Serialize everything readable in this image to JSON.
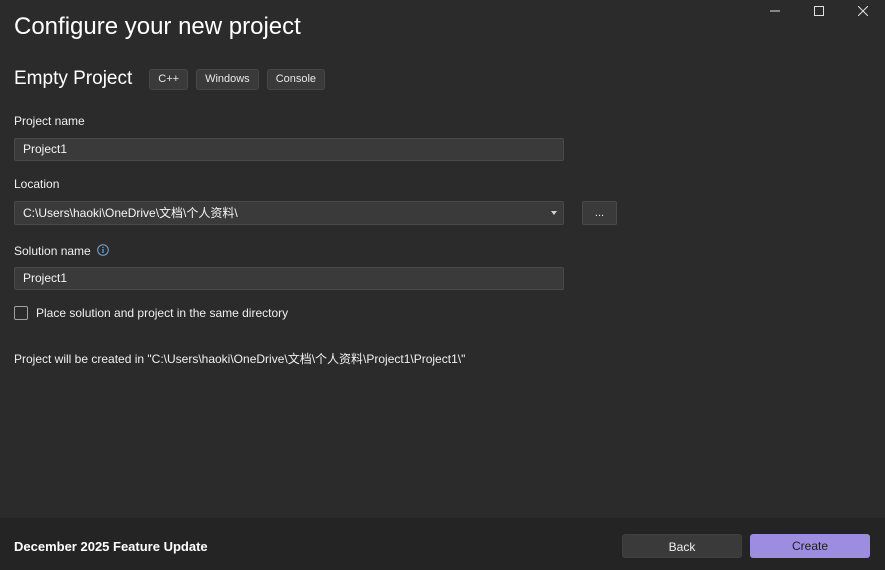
{
  "window": {
    "controls": [
      "minimize",
      "maximize",
      "close"
    ]
  },
  "page": {
    "title": "Configure your new project"
  },
  "template": {
    "name": "Empty Project",
    "tags": [
      "C++",
      "Windows",
      "Console"
    ]
  },
  "form": {
    "project_name_label": "Project name",
    "project_name_value": "Project1",
    "location_label": "Location",
    "location_value": "C:\\Users\\haoki\\OneDrive\\文档\\个人资料\\",
    "browse_label": "...",
    "solution_name_label": "Solution name",
    "solution_name_value": "Project1",
    "same_directory_label": "Place solution and project in the same directory",
    "same_directory_checked": false,
    "created_path_text": "Project will be created in \"C:\\Users\\haoki\\OneDrive\\文档\\个人资料\\Project1\\Project1\\\""
  },
  "footer": {
    "update_text": "December 2025 Feature Update",
    "back_label": "Back",
    "create_label": "Create"
  },
  "colors": {
    "background": "#2b2b2b",
    "footer_background": "#242424",
    "accent": "#9d8de0",
    "info_icon": "#6fa8dc"
  }
}
